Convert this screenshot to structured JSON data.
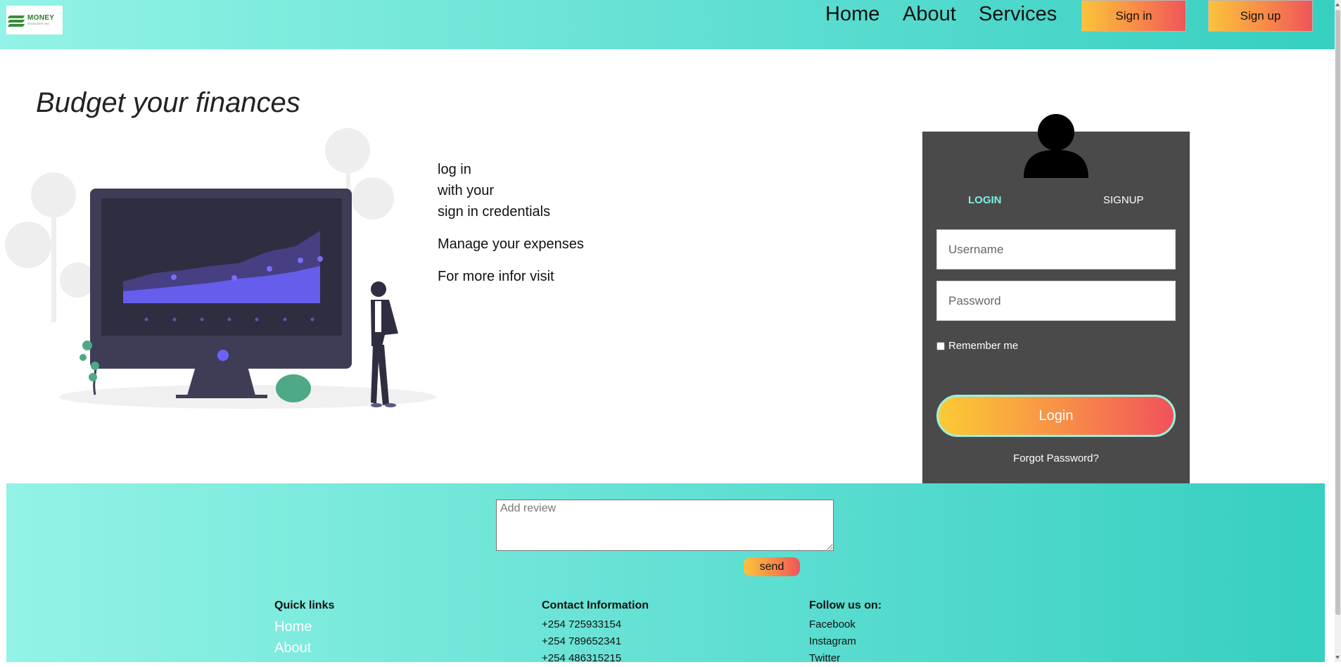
{
  "header": {
    "logo": {
      "line1": "MONEY",
      "line2": "MANAGER INC"
    },
    "nav": [
      "Home",
      "About",
      "Services"
    ],
    "sign_in_label": "Sign in",
    "sign_up_label": "Sign up",
    "background_gradient": [
      "#92f3e6",
      "#36cfc0"
    ]
  },
  "hero": {
    "title": "Budget your finances",
    "blurb": [
      "log in",
      "with your",
      "sign in credentials",
      "Manage your expenses",
      "For more infor visit"
    ]
  },
  "auth_panel": {
    "background": "#4a4a4a",
    "avatar_icon": "user-silhouette",
    "tabs": [
      "LOGIN",
      "SIGNUP"
    ],
    "active_tab": "LOGIN",
    "username_placeholder": "Username",
    "password_placeholder": "Password",
    "remember_label": "Remember me",
    "login_label": "Login",
    "forgot_label": "Forgot Password?",
    "accent": "#7ef0e2",
    "button_gradient": [
      "#fbcb34",
      "#f0525a"
    ]
  },
  "footer": {
    "review_placeholder": "Add review",
    "send_label": "send",
    "quick_links_title": "Quick links",
    "quick_links": [
      "Home",
      "About"
    ],
    "contact_title": "Contact Information",
    "phones": [
      "+254 725933154",
      "+254 789652341",
      "+254 486315215"
    ],
    "follow_title": "Follow us on:",
    "socials": [
      "Facebook",
      "Instagram",
      "Twitter"
    ]
  }
}
